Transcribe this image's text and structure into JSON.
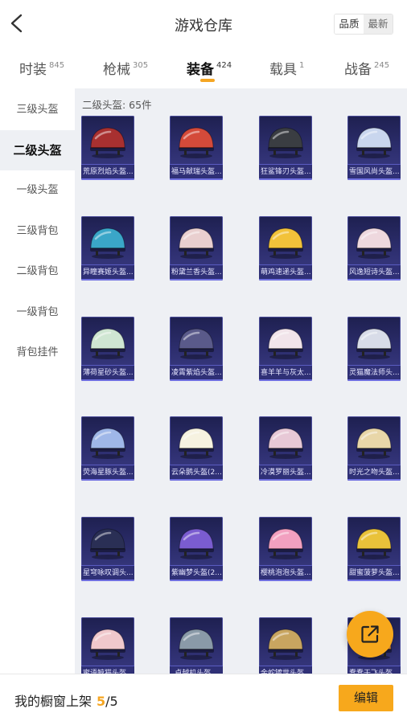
{
  "header": {
    "title": "游戏仓库",
    "sort_options": [
      "品质",
      "最新"
    ]
  },
  "tabs": [
    {
      "label": "时装",
      "count": "845"
    },
    {
      "label": "枪械",
      "count": "305"
    },
    {
      "label": "装备",
      "count": "424"
    },
    {
      "label": "载具",
      "count": "1"
    },
    {
      "label": "战备",
      "count": "245"
    }
  ],
  "sidebar": {
    "items": [
      "三级头盔",
      "二级头盔",
      "一级头盔",
      "三级背包",
      "二级背包",
      "一级背包",
      "背包挂件"
    ]
  },
  "section": {
    "title": "二级头盔: 65件"
  },
  "items": [
    {
      "name": "荒原烈焰头盔...",
      "icon": "helmet-red-icon",
      "color": "#a83030"
    },
    {
      "name": "福马献瑞头盔...",
      "icon": "helmet-red-icon",
      "color": "#d44a3a"
    },
    {
      "name": "狂鲨锋刃头盔...",
      "icon": "helmet-shark-icon",
      "color": "#3a3d42"
    },
    {
      "name": "雪国风尚头盔...",
      "icon": "helmet-snow-icon",
      "color": "#c9d6ee"
    },
    {
      "name": "异瞳赛姬头盔...",
      "icon": "helmet-teal-icon",
      "color": "#3aa6c8"
    },
    {
      "name": "粉黛兰香头盔...",
      "icon": "helmet-pink-icon",
      "color": "#e9cfcf"
    },
    {
      "name": "萌鸡速递头盔...",
      "icon": "helmet-chick-icon",
      "color": "#f2c23a"
    },
    {
      "name": "风逸短诗头盔...",
      "icon": "helmet-white-icon",
      "color": "#eed8de"
    },
    {
      "name": "薄荷星砂头盔...",
      "icon": "helmet-mint-icon",
      "color": "#cfe6d2"
    },
    {
      "name": "凌霄紫焰头盔...",
      "icon": "helmet-purple-icon",
      "color": "#5a5a8a"
    },
    {
      "name": "喜羊羊与灰太...",
      "icon": "helmet-sheep-icon",
      "color": "#f1e4ea"
    },
    {
      "name": "灵猫魔法师头...",
      "icon": "helmet-cat-icon",
      "color": "#d8dce8"
    },
    {
      "name": "荧海星豚头盔...",
      "icon": "helmet-dolphin-icon",
      "color": "#9fb7e8"
    },
    {
      "name": "云朵鹅头盔(2...",
      "icon": "helmet-goose-icon",
      "color": "#f6f2e0"
    },
    {
      "name": "冷漠罗丽头盔...",
      "icon": "helmet-lolita-icon",
      "color": "#e7c8d6"
    },
    {
      "name": "时光之吻头盔...",
      "icon": "helmet-gold-icon",
      "color": "#e8d6a8"
    },
    {
      "name": "星穹咏叹调头...",
      "icon": "helmet-navy-icon",
      "color": "#2a2f55"
    },
    {
      "name": "紫幽梦头盔(2...",
      "icon": "helmet-violet-icon",
      "color": "#7a5cd0"
    },
    {
      "name": "樱桃泡泡头盔...",
      "icon": "helmet-pig-icon",
      "color": "#f2a0c0"
    },
    {
      "name": "甜蜜菠萝头盔...",
      "icon": "helmet-pineapple-icon",
      "color": "#e9c23a"
    },
    {
      "name": "蜜语鲸猫头盔...",
      "icon": "helmet-pinkcat-icon",
      "color": "#f0c8cc"
    },
    {
      "name": "卓越机头盔...",
      "icon": "helmet-silver-icon",
      "color": "#8a9aa8"
    },
    {
      "name": "金蛇镀世头盔...",
      "icon": "helmet-snake-icon",
      "color": "#c8a560"
    },
    {
      "name": "蠢蠢于飞头盔...",
      "icon": "helmet-orange-icon",
      "color": "#e09040"
    }
  ],
  "bottom": {
    "showcase_label": "我的橱窗上架",
    "showcase_count": "5",
    "showcase_sep": "/",
    "showcase_total": "5",
    "edit_label": "编辑"
  },
  "colors": {
    "accent": "#f7a81c",
    "card_bg": "#2e2f70",
    "content_bg": "#eef0f4"
  }
}
